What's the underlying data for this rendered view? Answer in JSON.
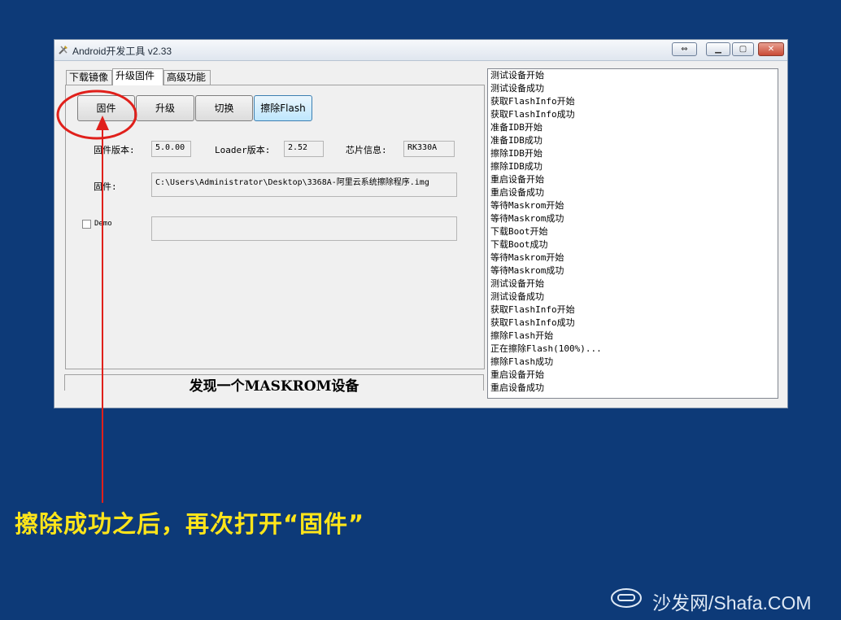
{
  "window": {
    "title": "Android开发工具 v2.33"
  },
  "tabs": [
    {
      "label": "下载镜像"
    },
    {
      "label": "升级固件"
    },
    {
      "label": "高级功能"
    }
  ],
  "buttons": {
    "firmware": "固件",
    "upgrade": "升级",
    "switch": "切换",
    "erase_flash": "擦除Flash"
  },
  "info": {
    "fw_version_label": "固件版本:",
    "fw_version_value": "5.0.00",
    "loader_version_label": "Loader版本:",
    "loader_version_value": "2.52",
    "chip_label": "芯片信息:",
    "chip_value": "RK330A",
    "firmware_label": "固件:",
    "firmware_path": "C:\\Users\\Administrator\\Desktop\\3368A-阿里云系统擦除程序.img",
    "demo_label": "Demo",
    "demo_value": ""
  },
  "status": "发现一个MASKROM设备",
  "log": [
    "测试设备开始",
    "测试设备成功",
    "获取FlashInfo开始",
    "获取FlashInfo成功",
    "准备IDB开始",
    "准备IDB成功",
    "擦除IDB开始",
    "擦除IDB成功",
    "重启设备开始",
    "重启设备成功",
    "等待Maskrom开始",
    "等待Maskrom成功",
    "下载Boot开始",
    "下载Boot成功",
    "等待Maskrom开始",
    "等待Maskrom成功",
    "测试设备开始",
    "测试设备成功",
    "获取FlashInfo开始",
    "获取FlashInfo成功",
    "擦除Flash开始",
    "正在擦除Flash(100%)...",
    "擦除Flash成功",
    "重启设备开始",
    "重启设备成功"
  ],
  "annotation": {
    "caption": "擦除成功之后，再次打开“固件”",
    "highlight_color": "#e0201b",
    "caption_color": "#ffe51a"
  },
  "watermark": {
    "text": "沙发网/Shafa.COM",
    "icon": "sofa-icon"
  }
}
